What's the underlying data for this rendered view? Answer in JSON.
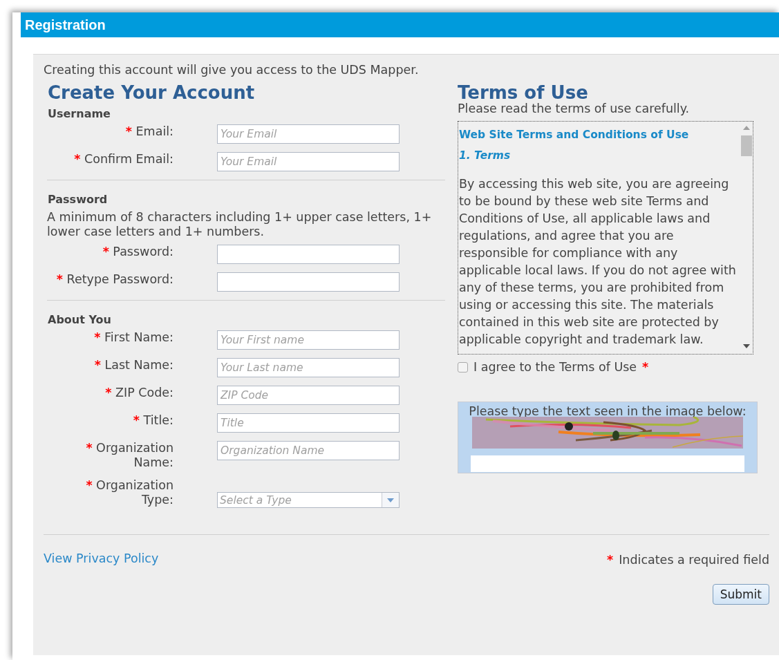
{
  "window": {
    "title": "Registration"
  },
  "intro": "Creating this account will give you access to the UDS Mapper.",
  "account": {
    "heading": "Create Your Account",
    "sections": [
      {
        "title": "Username",
        "fields": [
          {
            "label": "Email:",
            "required_mark": "*",
            "kind": "text",
            "placeholder": "Your Email"
          },
          {
            "label": "Confirm Email:",
            "required_mark": "*",
            "kind": "text",
            "placeholder": "Your Email"
          }
        ]
      },
      {
        "title": "Password",
        "note": "A minimum of 8 characters including 1+ upper case letters, 1+ lower case letters and 1+ numbers.",
        "fields": [
          {
            "label": "Password:",
            "required_mark": "*",
            "kind": "password"
          },
          {
            "label": "Retype Password:",
            "required_mark": "*",
            "kind": "password"
          }
        ]
      },
      {
        "title": "About You",
        "fields": [
          {
            "label": "First Name:",
            "required_mark": "*",
            "kind": "text",
            "placeholder": "Your First name"
          },
          {
            "label": "Last Name:",
            "required_mark": "*",
            "kind": "text",
            "placeholder": "Your Last name"
          },
          {
            "label": "ZIP Code:",
            "required_mark": "*",
            "kind": "text",
            "placeholder": "ZIP Code"
          },
          {
            "label": "Title:",
            "required_mark": "*",
            "kind": "text",
            "placeholder": "Title"
          },
          {
            "label": "Organization Name:",
            "required_mark": "*",
            "kind": "text",
            "placeholder": "Organization Name"
          },
          {
            "label": "Organization Type:",
            "required_mark": "*",
            "kind": "select",
            "placeholder": "Select a Type"
          }
        ]
      }
    ]
  },
  "terms": {
    "heading": "Terms of Use",
    "subtitle": "Please read the terms of use carefully.",
    "title": "Web Site Terms and Conditions of Use",
    "section": "1. Terms",
    "body": "By accessing this web site, you are agreeing to be bound by these web site Terms and Conditions of Use, all applicable laws and regulations, and agree that you are responsible for compliance with any applicable local laws. If you do not agree with any of these terms, you are prohibited from using or accessing this site. The materials contained in this web site are protected by applicable copyright and trademark law.",
    "agree": {
      "label": "I agree to the Terms of Use",
      "checked": false,
      "required_mark": "*"
    }
  },
  "captcha": {
    "prompt": "Please type the text seen in the image below:",
    "kind": "picture"
  },
  "footer": {
    "privacy_link": "View Privacy Policy",
    "required_mark": "*",
    "required_note": "Indicates a required field",
    "submit": "Submit"
  }
}
